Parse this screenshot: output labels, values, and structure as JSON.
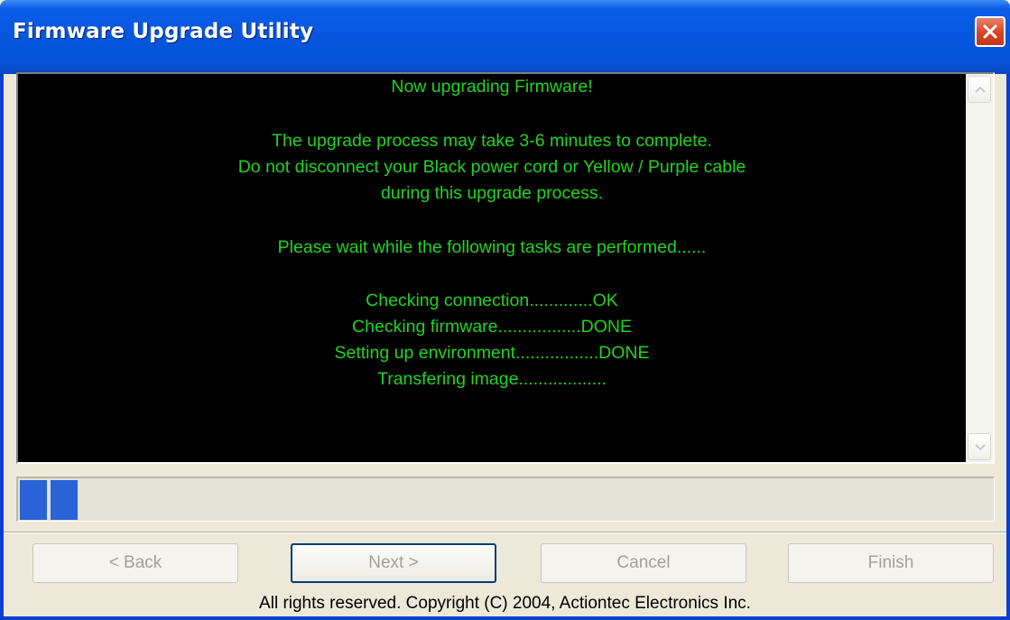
{
  "window": {
    "title": "Firmware Upgrade Utility"
  },
  "console": {
    "lines": {
      "heading": "Now upgrading Firmware!",
      "duration": "The upgrade process may take 3-6 minutes to complete.",
      "warning1": "Do not disconnect your Black power cord or Yellow / Purple cable",
      "warning2": "during this upgrade process.",
      "wait": "Please wait while the following tasks are performed......",
      "task1": "Checking connection.............OK",
      "task2": "Checking firmware.................DONE",
      "task3": "Setting up environment.................DONE",
      "task4": "Transfering image.................."
    },
    "text_color": "#22d322",
    "background_color": "#000000"
  },
  "scrollbar": {
    "up_icon": "scroll-up-arrow-icon",
    "down_icon": "scroll-down-arrow-icon"
  },
  "progress": {
    "filled_blocks": 2,
    "fill_color": "#2a63d6"
  },
  "buttons": {
    "back": "< Back",
    "next": "Next >",
    "cancel": "Cancel",
    "finish": "Finish"
  },
  "footer": {
    "copyright": "All rights reserved. Copyright (C) 2004, Actiontec Electronics Inc."
  }
}
